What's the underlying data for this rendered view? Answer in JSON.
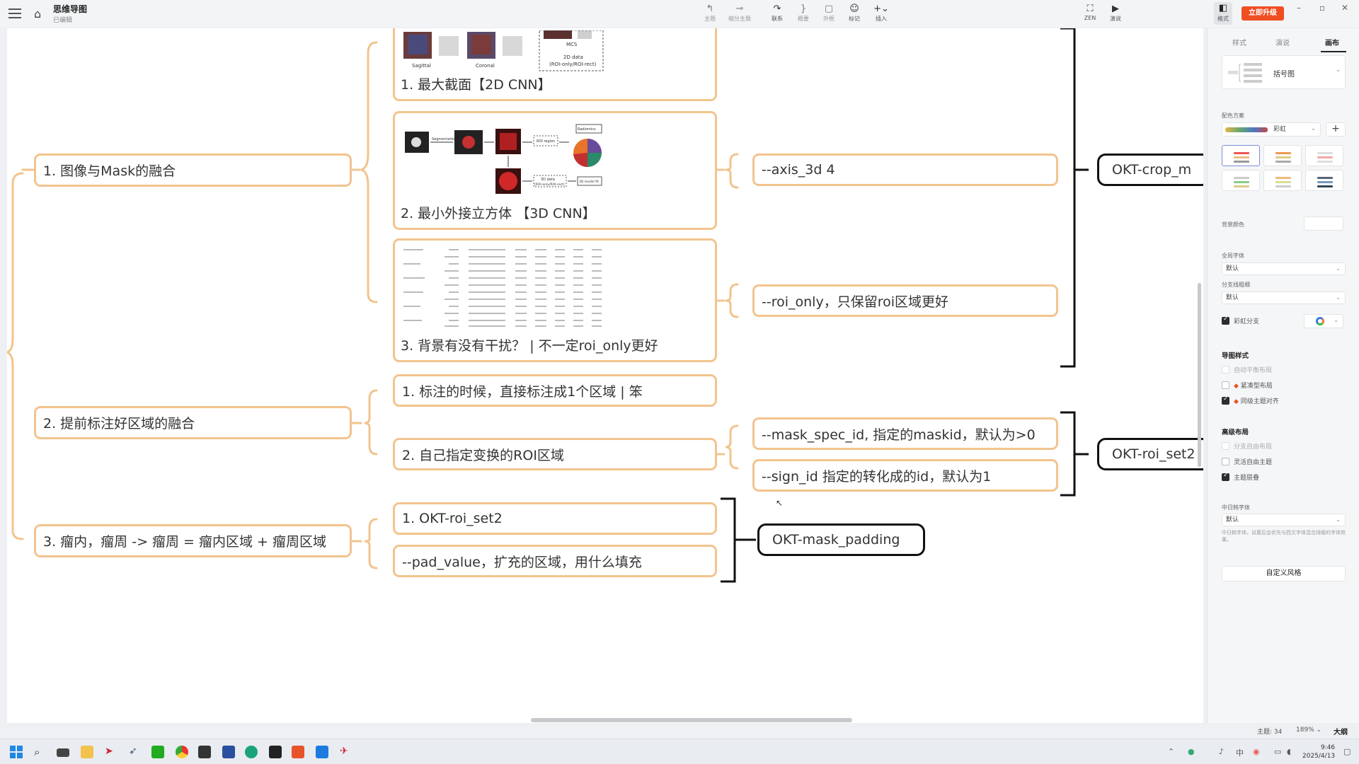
{
  "app": {
    "title": "思维导图",
    "subtitle": "已编辑",
    "upgrade_label": "立即升级",
    "sidepanel_label": "格式"
  },
  "toolbar": {
    "items": [
      {
        "label": "主题",
        "icon": "topic-icon"
      },
      {
        "label": "缩分主题",
        "icon": "subtopic-icon"
      },
      {
        "label": "联系",
        "icon": "relation-icon"
      },
      {
        "label": "概要",
        "icon": "summary-icon"
      },
      {
        "label": "外框",
        "icon": "boundary-icon"
      },
      {
        "label": "标记",
        "icon": "marker-icon"
      },
      {
        "label": "插入",
        "icon": "insert-icon"
      },
      {
        "label": "ZEN",
        "icon": "fullscreen-icon"
      },
      {
        "label": "演说",
        "icon": "present-icon"
      }
    ]
  },
  "mindmap": {
    "level1": [
      "1. 图像与Mask的融合",
      "2. 提前标注好区域的融合",
      "3. 瘤内，瘤周 -> 瘤周 = 瘤内区域 + 瘤周区域"
    ],
    "level2": [
      "1. 最大截面【2D CNN】",
      "2. 最小外接立方体 【3D CNN】",
      "3. 背景有没有干扰？ | 不一定roi_only更好",
      "1. 标注的时候，直接标注成1个区域 | 笨",
      "2. 自己指定变换的ROI区域",
      "1. OKT-roi_set2",
      "--pad_value，扩充的区域，用什么填充"
    ],
    "level3": [
      "--axis_3d 4",
      "--roi_only，只保留roi区域更好",
      "--mask_spec_id, 指定的maskid，默认为>0",
      "--sign_id 指定的转化成的id，默认为1"
    ],
    "summaries": [
      "OKT-crop_m",
      "OKT-roi_set2",
      "OKT-mask_padding"
    ],
    "thumb_labels": {
      "sagittal": "Sagittal",
      "coronal": "Coronal",
      "mcs": "MCS",
      "data2d": "2D data",
      "roi_only": "(ROI-only/ROI-rect)",
      "segmentation": "Segmentation",
      "roi_region": "ROI region",
      "radiomics": "Radiomics",
      "data3d": "3D data",
      "roi_only3d": "(ROI-only/ROI-rect)",
      "model3d": "3D model fit"
    }
  },
  "panel": {
    "tabs": [
      "样式",
      "演说",
      "画布"
    ],
    "active_tab": "画布",
    "structure_label": "括号图",
    "color_scheme_label": "配色方案",
    "color_scheme_value": "彩虹",
    "bg_color_label": "背景颜色",
    "global_font_label": "全局字体",
    "global_font_value": "默认",
    "branch_line_label": "分支线粗细",
    "branch_line_value": "默认",
    "rainbow_branch_label": "彩虹分支",
    "map_style_title": "导图样式",
    "map_style_options": [
      {
        "label": "自动平衡布局",
        "checked": false,
        "dim": true
      },
      {
        "label": "紧凑型布局",
        "checked": false,
        "dim": false
      },
      {
        "label": "同级主题对齐",
        "checked": true,
        "dim": false
      }
    ],
    "advanced_title": "高级布局",
    "advanced_options": [
      {
        "label": "分支自由布局",
        "checked": false,
        "dim": true
      },
      {
        "label": "灵活自由主题",
        "checked": false,
        "dim": false
      },
      {
        "label": "主题层叠",
        "checked": true,
        "dim": false
      }
    ],
    "cjk_font_label": "中日韩字体",
    "cjk_font_value": "默认",
    "cjk_font_note": "中日韩字体，设置后会优先与西文字体混合排版的字体效果。",
    "custom_style_label": "自定义风格"
  },
  "status": {
    "topics": "主题: 34",
    "zoom": "189%",
    "outline": "大纲"
  },
  "taskbar": {
    "time": "9:46",
    "date": "2025/4/13"
  },
  "colors": {
    "accent": "#f04e23",
    "node_border": "#f2c48e",
    "summary_border": "#111111"
  }
}
